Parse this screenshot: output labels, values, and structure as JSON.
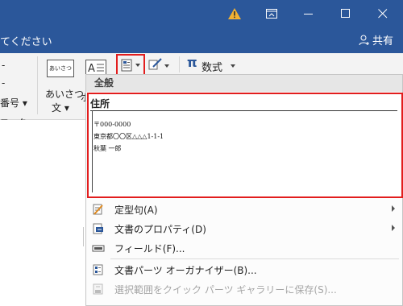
{
  "titlebar": {
    "warning_glyph": "⚠"
  },
  "subbar": {
    "hint": "てください",
    "share_label": "共有"
  },
  "ribbon": {
    "left_dash": "-",
    "left_dash2": "-",
    "numbering_label": "番号",
    "footer_label": "フッター",
    "greeting_icon_text": "あいさつ",
    "greeting_label_1": "あいさつ",
    "greeting_label_2": "文",
    "textbox_cut_label": "ボ",
    "math_symbol": "π",
    "math_label": "数式"
  },
  "menu": {
    "header": "全般",
    "gallery_item": {
      "title": "住所",
      "lines": [
        "〒000-0000",
        "東京都〇〇区△△△1-1-1",
        "秋葉 一郎"
      ]
    },
    "items": [
      {
        "label": "定型句(A)",
        "icon": "autotext-icon"
      },
      {
        "label": "文書のプロパティ(D)",
        "icon": "document-property-icon"
      },
      {
        "label": "フィールド(F)...",
        "icon": "field-icon"
      },
      {
        "label": "文書パーツ オーガナイザー(B)...",
        "icon": "organizer-icon"
      },
      {
        "label": "選択範囲をクイック パーツ ギャラリーに保存(S)...",
        "icon": "save-selection-icon"
      }
    ]
  },
  "colors": {
    "title_bar": "#2b579a",
    "highlight": "#e21d1d",
    "ribbon_bg": "#f3f3f3"
  }
}
